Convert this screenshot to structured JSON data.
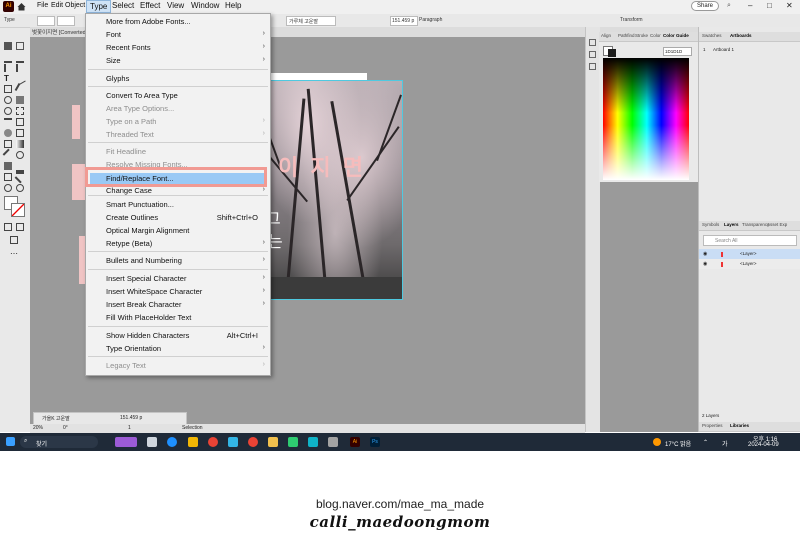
{
  "menubar": {
    "items": [
      "File",
      "Edit",
      "Object",
      "Type",
      "Select",
      "Effect",
      "View",
      "Window",
      "Help"
    ],
    "share_label": "Share"
  },
  "control": {
    "type_label": "Type",
    "font_label": "가루체 고운딸",
    "size_label": "151.459 p",
    "para_label": "Paragraph",
    "transform_label": "Transform"
  },
  "document": {
    "tab_label": "벚꽃이지면 [Converted]"
  },
  "panels": {
    "color_tabs": [
      "Align",
      "Pathfind",
      "Stroke",
      "Color",
      "Color Guide"
    ],
    "hex_value": "1D1D1D",
    "swatches_tab": "Swatches",
    "artboards_tab": "Artboards",
    "artboard_item": "Artboard 1",
    "artboard_index": "1",
    "layer_tabs": [
      "Symbols",
      "Layers",
      "Transparency",
      "Asset Exp"
    ],
    "search_placeholder": "Search All",
    "layer1": "<Layer>",
    "layer2": "<Layer>",
    "layer_count": "2 Layers",
    "bottom_tabs": [
      "Properties",
      "Libraries"
    ]
  },
  "artwork": {
    "title": "이 지 면",
    "sub1": "그",
    "sub2": "는"
  },
  "type_menu": {
    "items": [
      {
        "label": "More from Adobe Fonts...",
        "shortcut": "",
        "submenu": false,
        "disabled": false
      },
      {
        "label": "Font",
        "shortcut": "",
        "submenu": true,
        "disabled": false
      },
      {
        "label": "Recent Fonts",
        "shortcut": "",
        "submenu": true,
        "disabled": false
      },
      {
        "label": "Size",
        "shortcut": "",
        "submenu": true,
        "disabled": false
      },
      {
        "label": "Glyphs",
        "shortcut": "",
        "submenu": false,
        "disabled": false
      },
      {
        "label": "Convert To Area Type",
        "shortcut": "",
        "submenu": false,
        "disabled": false
      },
      {
        "label": "Area Type Options...",
        "shortcut": "",
        "submenu": false,
        "disabled": true
      },
      {
        "label": "Type on a Path",
        "shortcut": "",
        "submenu": true,
        "disabled": true
      },
      {
        "label": "Threaded Text",
        "shortcut": "",
        "submenu": true,
        "disabled": true
      },
      {
        "label": "Fit Headline",
        "shortcut": "",
        "submenu": false,
        "disabled": true
      },
      {
        "label": "Resolve Missing Fonts...",
        "shortcut": "",
        "submenu": false,
        "disabled": true
      },
      {
        "label": "Find/Replace Font...",
        "shortcut": "",
        "submenu": false,
        "disabled": false
      },
      {
        "label": "Change Case",
        "shortcut": "",
        "submenu": true,
        "disabled": false
      },
      {
        "label": "Smart Punctuation...",
        "shortcut": "",
        "submenu": false,
        "disabled": false
      },
      {
        "label": "Create Outlines",
        "shortcut": "Shift+Ctrl+O",
        "submenu": false,
        "disabled": false
      },
      {
        "label": "Optical Margin Alignment",
        "shortcut": "",
        "submenu": false,
        "disabled": false
      },
      {
        "label": "Retype (Beta)",
        "shortcut": "",
        "submenu": true,
        "disabled": false
      },
      {
        "label": "Bullets and Numbering",
        "shortcut": "",
        "submenu": true,
        "disabled": false
      },
      {
        "label": "Insert Special Character",
        "shortcut": "",
        "submenu": true,
        "disabled": false
      },
      {
        "label": "Insert WhiteSpace Character",
        "shortcut": "",
        "submenu": true,
        "disabled": false
      },
      {
        "label": "Insert Break Character",
        "shortcut": "",
        "submenu": true,
        "disabled": false
      },
      {
        "label": "Fill With PlaceHolder Text",
        "shortcut": "",
        "submenu": false,
        "disabled": false
      },
      {
        "label": "Show Hidden Characters",
        "shortcut": "Alt+Ctrl+I",
        "submenu": false,
        "disabled": false
      },
      {
        "label": "Type Orientation",
        "shortcut": "",
        "submenu": true,
        "disabled": false
      },
      {
        "label": "Legacy Text",
        "shortcut": "",
        "submenu": true,
        "disabled": true
      }
    ]
  },
  "status": {
    "zoom": "20%",
    "angle": "0°",
    "page": "1",
    "mode": "Selection",
    "font_float": "가을K 고운딸",
    "size_float": "151.459 p"
  },
  "taskbar": {
    "search_label": "찾기",
    "weather": "17°C 맑음",
    "ime": "가",
    "time": "오후 1:16",
    "date": "2024-04-09"
  },
  "footer": {
    "url": "blog.naver.com/mae_ma_made",
    "signature": "calli_maedoongmom"
  },
  "colors": {
    "highlight": "#99c9f5",
    "callout_border": "#f19a93",
    "canvas": "#9a9a9a"
  }
}
